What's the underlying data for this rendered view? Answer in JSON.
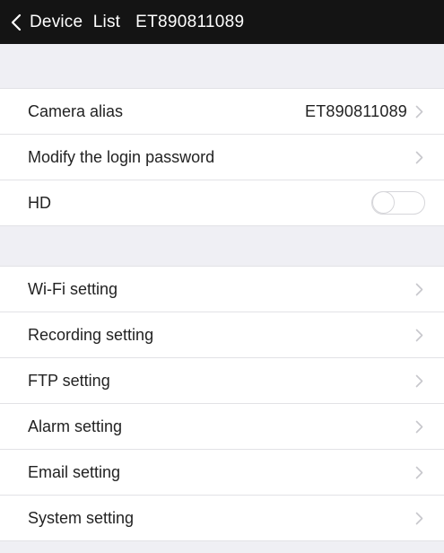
{
  "header": {
    "back_label": "Device List",
    "title": "ET890811089"
  },
  "section1": {
    "rows": [
      {
        "label": "Camera alias",
        "value": "ET890811089"
      },
      {
        "label": "Modify the login password"
      },
      {
        "label": "HD",
        "toggle_on": false
      }
    ]
  },
  "section2": {
    "rows": [
      {
        "label": "Wi-Fi setting"
      },
      {
        "label": "Recording setting"
      },
      {
        "label": "FTP setting"
      },
      {
        "label": "Alarm setting"
      },
      {
        "label": "Email setting"
      },
      {
        "label": "System setting"
      }
    ]
  },
  "colors": {
    "header_bg": "#141414",
    "section_bg": "#efeff4",
    "chevron": "#c7c7cc"
  },
  "icons": {
    "back": "chevron-left-icon",
    "row_disclosure": "chevron-right-icon"
  }
}
